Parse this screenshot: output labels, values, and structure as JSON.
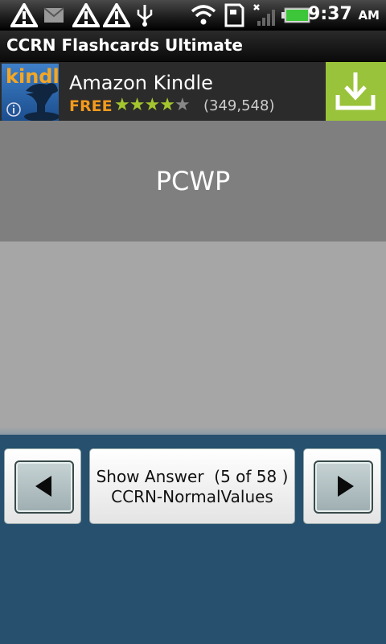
{
  "status_bar": {
    "time": "9:37",
    "ampm": "AM",
    "icons": [
      "alert-icon",
      "mail-icon",
      "alert-icon",
      "alert-icon",
      "usb-icon",
      "wifi-icon",
      "sd-card-icon",
      "no-signal-icon",
      "battery-icon"
    ]
  },
  "app": {
    "title": "CCRN Flashcards Ultimate"
  },
  "ad": {
    "thumb_label": "kindle",
    "title": "Amazon Kindle",
    "price": "FREE",
    "rating": 4,
    "rating_max": 5,
    "review_count": "(349,548)",
    "accent": "#99c33a"
  },
  "card": {
    "front_text": "PCWP",
    "back_text": ""
  },
  "controls": {
    "show_answer_line1": "Show Answer  (5 of 58 )",
    "show_answer_line2": "CCRN-NormalValues"
  }
}
